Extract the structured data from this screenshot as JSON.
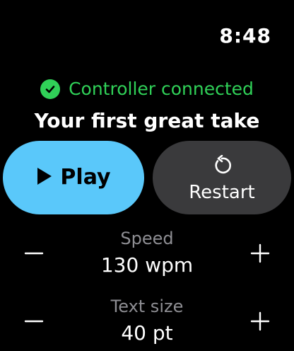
{
  "status_bar": {
    "time": "8:48"
  },
  "connection": {
    "text": "Controller connected",
    "icon": "checkmark-circle-icon",
    "color": "#30d158"
  },
  "take": {
    "title": "Your first great take"
  },
  "controls": {
    "play_label": "Play",
    "play_color": "#5ac8fa",
    "restart_label": "Restart",
    "restart_color": "#3a3a3c"
  },
  "speed": {
    "label": "Speed",
    "value": "130 wpm",
    "decrement_icon": "minus-icon",
    "increment_icon": "plus-icon"
  },
  "text_size": {
    "label": "Text size",
    "value": "40 pt",
    "decrement_icon": "minus-icon",
    "increment_icon": "plus-icon"
  },
  "colors": {
    "label_gray": "#8e8e93",
    "background": "#000000"
  }
}
